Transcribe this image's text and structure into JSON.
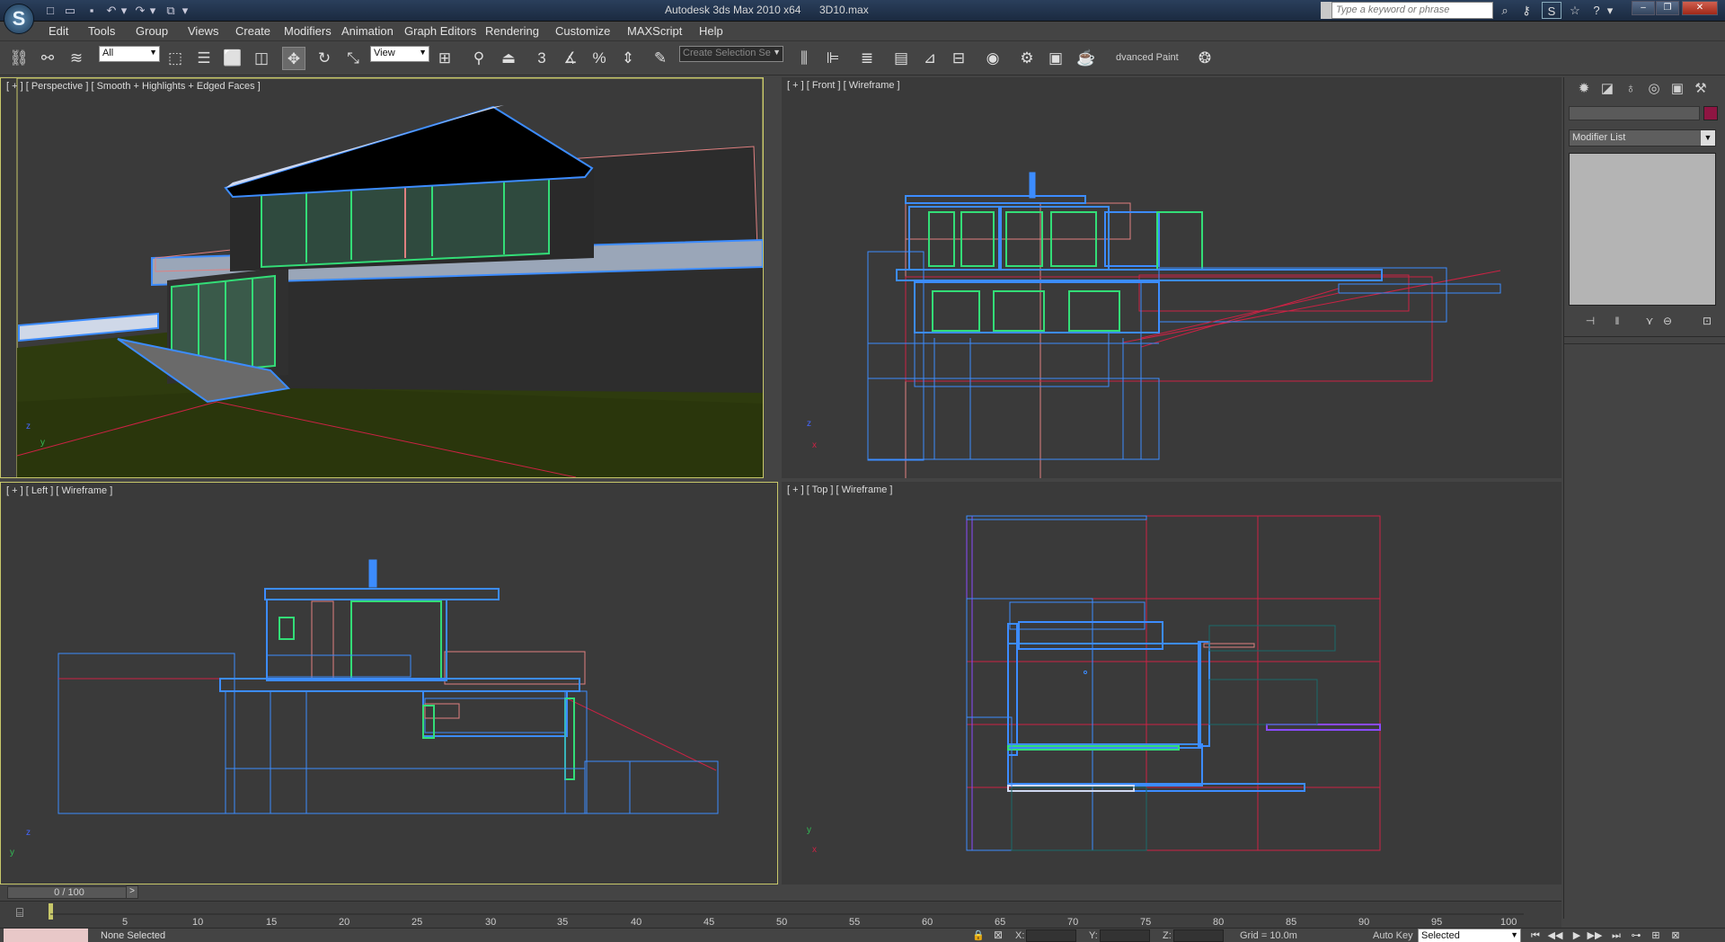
{
  "app": {
    "title": "Autodesk 3ds Max  2010 x64",
    "file": "3D10.max",
    "logo_glyph": "S",
    "search_placeholder": "Type a keyword or phrase"
  },
  "quick_access": [
    {
      "name": "new-file-icon",
      "glyph": "□"
    },
    {
      "name": "open-file-icon",
      "glyph": "▭"
    },
    {
      "name": "save-icon",
      "glyph": "▪"
    },
    {
      "name": "undo-icon",
      "glyph": "↶"
    },
    {
      "name": "undo-dropdown-icon",
      "glyph": "▾"
    },
    {
      "name": "redo-icon",
      "glyph": "↷"
    },
    {
      "name": "redo-dropdown-icon",
      "glyph": "▾"
    },
    {
      "name": "project-folder-icon",
      "glyph": "⧉"
    },
    {
      "name": "quick-access-dropdown-icon",
      "glyph": "▾"
    }
  ],
  "info_center": [
    {
      "name": "binoculars-icon",
      "glyph": "⌕"
    },
    {
      "name": "key-icon",
      "glyph": "⚷"
    },
    {
      "name": "subscription-icon",
      "glyph": "S"
    },
    {
      "name": "favorites-icon",
      "glyph": "☆"
    },
    {
      "name": "help-icon",
      "glyph": "?"
    },
    {
      "name": "help-dropdown-icon",
      "glyph": "▾"
    }
  ],
  "window_controls": {
    "minimize": "‒",
    "restore": "❐",
    "close": "✕"
  },
  "menus": [
    "Edit",
    "Tools",
    "Group",
    "Views",
    "Create",
    "Modifiers",
    "Animation",
    "Graph Editors",
    "Rendering",
    "Customize",
    "MAXScript",
    "Help"
  ],
  "toolbar": {
    "selection_filter": "All",
    "ref_coord": "View",
    "named_selection": "Create Selection Se",
    "advanced_paint": "dvanced Paint",
    "buttons": [
      {
        "name": "select-and-link-icon",
        "glyph": "⛓"
      },
      {
        "name": "unlink-icon",
        "glyph": "⚯"
      },
      {
        "name": "bind-space-warp-icon",
        "glyph": "≋"
      },
      {
        "name": "select-object-icon",
        "glyph": "⬚"
      },
      {
        "name": "select-by-name-icon",
        "glyph": "☰"
      },
      {
        "name": "rect-selection-region-icon",
        "glyph": "⬜"
      },
      {
        "name": "window-crossing-icon",
        "glyph": "◫"
      },
      {
        "name": "select-and-move-icon",
        "glyph": "✥"
      },
      {
        "name": "select-and-rotate-icon",
        "glyph": "↻"
      },
      {
        "name": "select-and-scale-icon",
        "glyph": "⤡"
      },
      {
        "name": "use-pivot-point-icon",
        "glyph": "⊞"
      },
      {
        "name": "select-manipulate-icon",
        "glyph": "⚲"
      },
      {
        "name": "keyboard-shortcut-override-icon",
        "glyph": "⏏"
      },
      {
        "name": "snaps-toggle-icon",
        "glyph": "3"
      },
      {
        "name": "angle-snap-icon",
        "glyph": "∡"
      },
      {
        "name": "percent-snap-icon",
        "glyph": "%"
      },
      {
        "name": "spinner-snap-icon",
        "glyph": "⇕"
      },
      {
        "name": "edit-named-selections-icon",
        "glyph": "✎"
      },
      {
        "name": "mirror-icon",
        "glyph": "⫼"
      },
      {
        "name": "align-icon",
        "glyph": "⊫"
      },
      {
        "name": "layer-manager-icon",
        "glyph": "≣"
      },
      {
        "name": "graphite-ribbon-icon",
        "glyph": "▤"
      },
      {
        "name": "curve-editor-icon",
        "glyph": "⊿"
      },
      {
        "name": "schematic-view-icon",
        "glyph": "⊟"
      },
      {
        "name": "material-editor-icon",
        "glyph": "◉"
      },
      {
        "name": "render-setup-icon",
        "glyph": "⚙"
      },
      {
        "name": "rendered-frame-window-icon",
        "glyph": "▣"
      },
      {
        "name": "render-production-icon",
        "glyph": "☕"
      },
      {
        "name": "advanced-paint-icon",
        "glyph": "❂"
      }
    ]
  },
  "viewports": {
    "perspective": "[ + ] [ Perspective ] [ Smooth + Highlights + Edged Faces ]",
    "front": "[ + ] [ Front ] [ Wireframe ]",
    "left": "[ + ] [ Left ] [ Wireframe ]",
    "top": "[ + ] [ Top ] [ Wireframe ]"
  },
  "axis_labels": {
    "z": "z",
    "y": "y",
    "x": "x"
  },
  "command_panel": {
    "tabs": [
      {
        "name": "create-tab-icon",
        "glyph": "✹"
      },
      {
        "name": "modify-tab-icon",
        "glyph": "◪"
      },
      {
        "name": "hierarchy-tab-icon",
        "glyph": "♁"
      },
      {
        "name": "motion-tab-icon",
        "glyph": "◎"
      },
      {
        "name": "display-tab-icon",
        "glyph": "▣"
      },
      {
        "name": "utilities-tab-icon",
        "glyph": "⚒"
      }
    ],
    "modifier_list": "Modifier List",
    "stack_buttons": [
      {
        "name": "pin-stack-icon",
        "glyph": "⊣"
      },
      {
        "name": "show-end-result-icon",
        "glyph": "‖"
      },
      {
        "name": "make-unique-icon",
        "glyph": "⋎"
      },
      {
        "name": "remove-modifier-icon",
        "glyph": "⊖"
      },
      {
        "name": "configure-modifier-sets-icon",
        "glyph": "⊡"
      }
    ],
    "object_color": "#8e1542"
  },
  "timeline": {
    "frame": "0 / 100",
    "next_glyph": ">",
    "ticks": [
      "5",
      "10",
      "15",
      "20",
      "25",
      "30",
      "35",
      "40",
      "45",
      "50",
      "55",
      "60",
      "65",
      "70",
      "75",
      "80",
      "85",
      "90",
      "95",
      "100"
    ]
  },
  "status": {
    "selection": "None Selected",
    "x_label": "X:",
    "y_label": "Y:",
    "z_label": "Z:",
    "grid": "Grid = 10.0m",
    "auto_key": "Auto Key",
    "key_filter": "Selected",
    "playback": [
      {
        "name": "go-to-start-icon",
        "glyph": "⏮"
      },
      {
        "name": "previous-frame-icon",
        "glyph": "◀◀"
      },
      {
        "name": "play-icon",
        "glyph": "▶"
      },
      {
        "name": "next-frame-icon",
        "glyph": "▶▶"
      },
      {
        "name": "go-to-end-icon",
        "glyph": "⏭"
      },
      {
        "name": "key-mode-icon",
        "glyph": "⊶"
      },
      {
        "name": "zoom-extents-icon",
        "glyph": "⊞"
      },
      {
        "name": "field-of-view-icon",
        "glyph": "⊠"
      }
    ]
  },
  "colors": {
    "accent_blue": "#3c8cff",
    "wire_green": "#33dd77",
    "wire_red": "#cc2244",
    "wire_pink": "#e08080",
    "ground": "#2e3b0e",
    "active_viewport_border": "#c8c86a"
  }
}
